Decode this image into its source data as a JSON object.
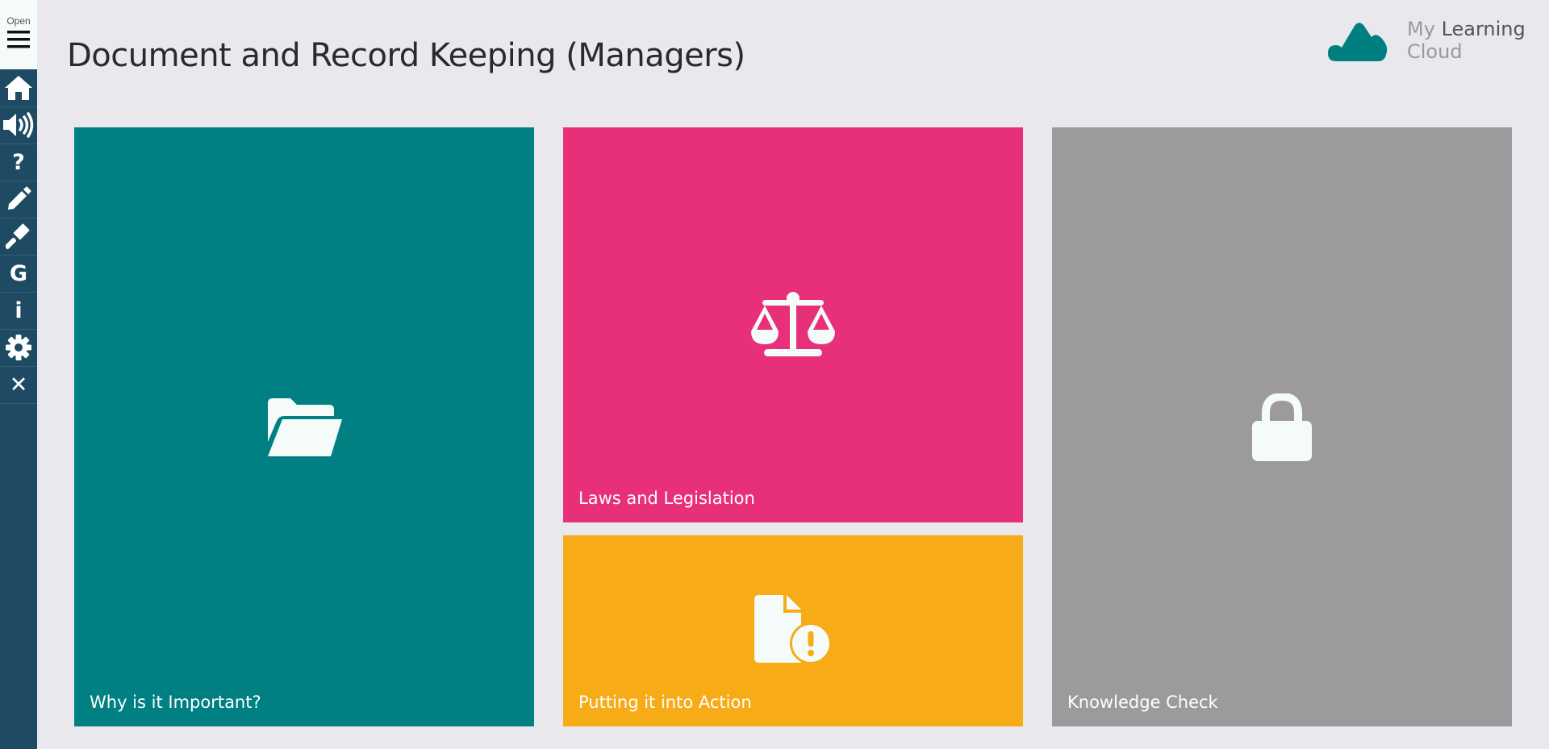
{
  "sidebar": {
    "open_label": "Open",
    "items": [
      {
        "icon": "home-icon"
      },
      {
        "icon": "audio-icon"
      },
      {
        "icon": "help-icon",
        "glyph": "?"
      },
      {
        "icon": "pencil-icon"
      },
      {
        "icon": "gavel-icon"
      },
      {
        "icon": "glossary-icon",
        "glyph": "G"
      },
      {
        "icon": "info-icon",
        "glyph": "i"
      },
      {
        "icon": "gear-icon"
      },
      {
        "icon": "close-icon",
        "glyph": "✕"
      }
    ]
  },
  "header": {
    "title": "Document and Record Keeping (Managers)"
  },
  "logo": {
    "word1": "My",
    "word2": "Learning",
    "word3": "Cloud",
    "color": "#007f80"
  },
  "tiles": [
    {
      "label": "Why is it Important?",
      "icon": "folder-open-icon",
      "color": "#008083"
    },
    {
      "label": "Laws and Legislation",
      "icon": "scales-icon",
      "color": "#e8307a"
    },
    {
      "label": "Putting it into Action",
      "icon": "file-alert-icon",
      "color": "#f7ab17"
    },
    {
      "label": "Knowledge Check",
      "icon": "lock-icon",
      "color": "#9c9a9d"
    }
  ]
}
